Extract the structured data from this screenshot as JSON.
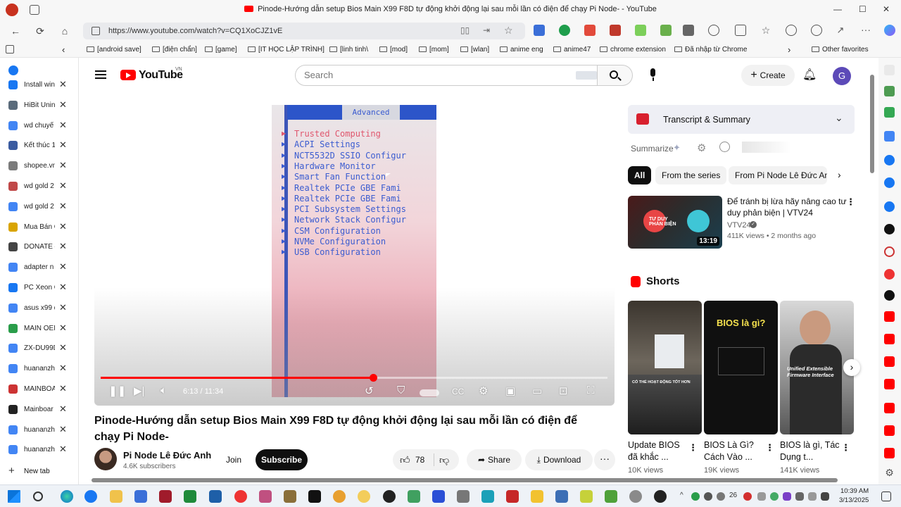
{
  "window": {
    "title": "Pinode-Hướng dẫn setup Bios Main X99 F8D tự động khởi động lại sau mỗi lần có điện để chạy Pi Node- - YouTube",
    "min": "—",
    "max": "☐",
    "close": "✕"
  },
  "browser": {
    "url": "https://www.youtube.com/watch?v=CQ1XoCJZ1vE",
    "bookmarks": [
      "[android save]",
      "[điện chẩn]",
      "[game]",
      "[IT HỌC LẬP TRÌNH]",
      "[linh tinh\\",
      "[mod]",
      "[mom]",
      "[wlan]",
      "anime eng",
      "anime47",
      "chrome extension",
      "Đã nhập từ Chrome"
    ],
    "other_favorites": "Other favorites",
    "more_bookmarks": "›",
    "back_bm": "‹"
  },
  "tabs": [
    {
      "label": "Install win",
      "color": "#1877f2"
    },
    {
      "label": "HiBit Unin",
      "color": "#5a6b7b"
    },
    {
      "label": "wd chuyể",
      "color": "#4285f4"
    },
    {
      "label": "Kết thúc 1",
      "color": "#3a5ba0"
    },
    {
      "label": "shopee.vn",
      "color": "#7b7b7b"
    },
    {
      "label": "wd gold 2",
      "color": "#c04848"
    },
    {
      "label": "wd gold 2",
      "color": "#4285f4"
    },
    {
      "label": "Mua Bán C",
      "color": "#d9a400"
    },
    {
      "label": "DONATE –",
      "color": "#444"
    },
    {
      "label": "adapter n",
      "color": "#4285f4"
    },
    {
      "label": "PC Xeon G",
      "color": "#1877f2"
    },
    {
      "label": "asus x99 d",
      "color": "#4285f4"
    },
    {
      "label": "MAIN OEM",
      "color": "#2a9d4a"
    },
    {
      "label": "ZX-DU99D",
      "color": "#4285f4"
    },
    {
      "label": "huananzhi",
      "color": "#4285f4"
    },
    {
      "label": "MAINBOA",
      "color": "#c33"
    },
    {
      "label": "Mainboar",
      "color": "#222"
    },
    {
      "label": "huananzhi",
      "color": "#4285f4"
    },
    {
      "label": "huananzhi",
      "color": "#4285f4"
    }
  ],
  "new_tab": "New tab",
  "youtube": {
    "logo": "YouTube",
    "region": "VN",
    "search_placeholder": "Search",
    "create": "Create",
    "avatar": "G"
  },
  "player": {
    "bios_tab": "Advanced",
    "bios_items": [
      "Trusted Computing",
      "ACPI Settings",
      "NCT5532D SSIO Configur",
      "Hardware Monitor",
      "Smart Fan Function",
      "Realtek PCIe GBE Fami",
      "Realtek PCIe GBE Fami",
      "PCI Subsystem Settings",
      "Network Stack Configur",
      "CSM Configuration",
      "NVMe Configuration",
      "USB Configuration"
    ],
    "time": "6:13 / 11:34",
    "progress": 0.537
  },
  "video": {
    "title": "Pinode-Hướng dẫn setup Bios Main X99 F8D tự động khởi động lại sau mỗi lần có điện để chạy Pi Node-",
    "channel": "Pi Node Lê Đức Anh",
    "subscribers": "4.6K subscribers",
    "join": "Join",
    "subscribe": "Subscribe",
    "likes": "78",
    "share": "Share",
    "download": "Download"
  },
  "sidebar": {
    "transcript": "Transcript & Summary",
    "summarize": "Summarize",
    "chips": [
      "All",
      "From the series",
      "From Pi Node Lê Đức Anh"
    ],
    "rec": {
      "title": "Để tránh bị lừa hãy nâng cao tư duy phản biện | VTV24",
      "channel": "VTV24",
      "meta": "411K views • 2 months ago",
      "duration": "13:19",
      "thumb_text": "TƯ DUY PHẢN BIỆN"
    },
    "shorts_label": "Shorts",
    "shorts": [
      {
        "title": "Update BIOS đã khắc ...",
        "views": "10K views",
        "overlay": "CÓ THỂ HOẠT ĐỘNG TỐT HƠN"
      },
      {
        "title": "BIOS Là Gì? Cách Vào ...",
        "views": "19K views",
        "overlay": "BIOS là gì?"
      },
      {
        "title": "BIOS là gì, Tác Dụng t...",
        "views": "141K views",
        "overlay": "Unified Extensible Firmware Interface"
      }
    ]
  },
  "taskbar": {
    "time": "10:39 AM",
    "date": "3/13/2025",
    "badge": "26"
  },
  "colors": {
    "yt_red": "#ff0000",
    "accent_blue": "#065fd4"
  }
}
